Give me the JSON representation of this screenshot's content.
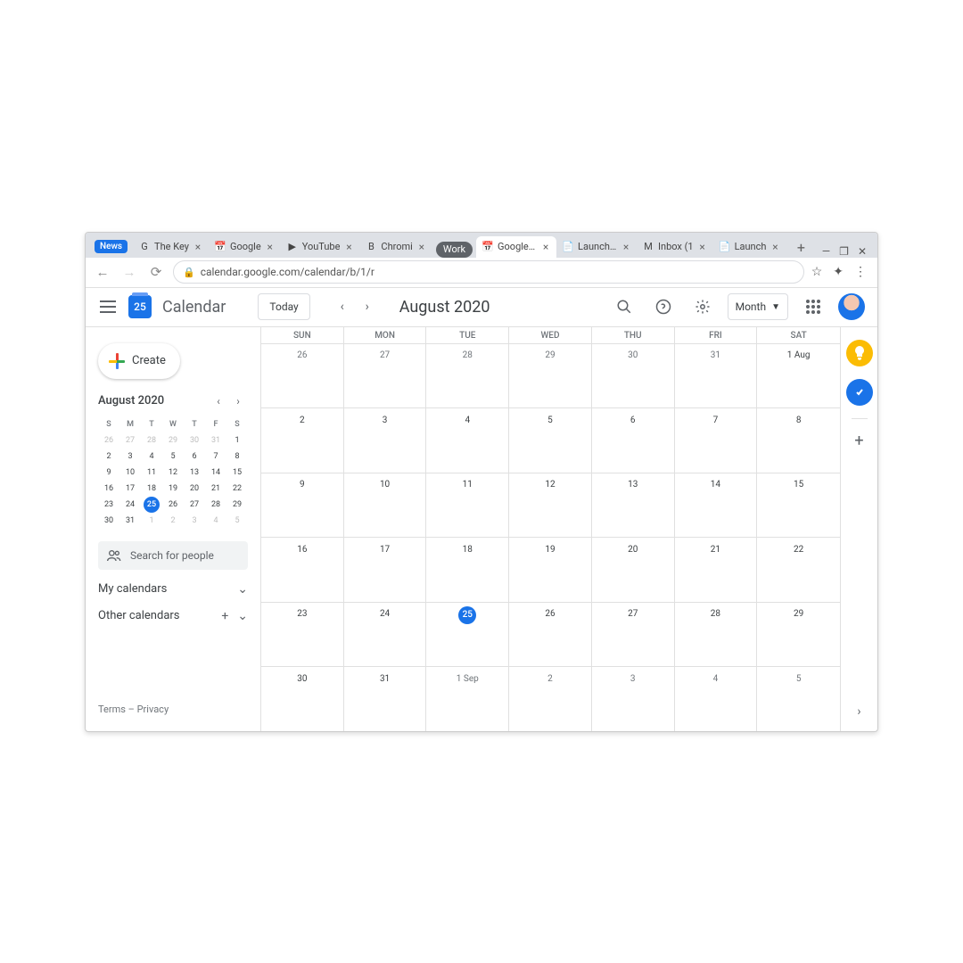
{
  "browser": {
    "tabs": [
      {
        "label": "News",
        "kind": "pill"
      },
      {
        "label": "The Key",
        "icon": "G"
      },
      {
        "label": "Google",
        "icon": "📅"
      },
      {
        "label": "YouTube",
        "icon": "▶"
      },
      {
        "label": "Chromi",
        "icon": "B"
      },
      {
        "label": "Work",
        "kind": "group"
      },
      {
        "label": "Google C",
        "icon": "📅",
        "active": true
      },
      {
        "label": "Launch Pr",
        "icon": "📄"
      },
      {
        "label": "Inbox (1",
        "icon": "M"
      },
      {
        "label": "Launch",
        "icon": "📄"
      }
    ],
    "url": "calendar.google.com/calendar/b/1/r"
  },
  "header": {
    "logo_day": "25",
    "app_title": "Calendar",
    "today_label": "Today",
    "current_range": "August 2020",
    "view_label": "Month"
  },
  "sidebar": {
    "create_label": "Create",
    "mini_title": "August 2020",
    "dows": [
      "S",
      "M",
      "T",
      "W",
      "T",
      "F",
      "S"
    ],
    "mini_days": [
      [
        26,
        27,
        28,
        29,
        30,
        31,
        1
      ],
      [
        2,
        3,
        4,
        5,
        6,
        7,
        8
      ],
      [
        9,
        10,
        11,
        12,
        13,
        14,
        15
      ],
      [
        16,
        17,
        18,
        19,
        20,
        21,
        22
      ],
      [
        23,
        24,
        25,
        26,
        27,
        28,
        29
      ],
      [
        30,
        31,
        1,
        2,
        3,
        4,
        5
      ]
    ],
    "mini_today_idx": [
      4,
      2
    ],
    "mini_other_start": true,
    "search_placeholder": "Search for people",
    "my_calendars": "My calendars",
    "other_calendars": "Other calendars",
    "footer_terms": "Terms",
    "footer_privacy": "Privacy"
  },
  "grid": {
    "dows": [
      "SUN",
      "MON",
      "TUE",
      "WED",
      "THU",
      "FRI",
      "SAT"
    ],
    "weeks": [
      [
        {
          "n": "26"
        },
        {
          "n": "27"
        },
        {
          "n": "28"
        },
        {
          "n": "29"
        },
        {
          "n": "30"
        },
        {
          "n": "31"
        },
        {
          "n": "1 Aug",
          "first": true,
          "this": true
        }
      ],
      [
        {
          "n": "2",
          "this": true
        },
        {
          "n": "3",
          "this": true
        },
        {
          "n": "4",
          "this": true
        },
        {
          "n": "5",
          "this": true
        },
        {
          "n": "6",
          "this": true
        },
        {
          "n": "7",
          "this": true
        },
        {
          "n": "8",
          "this": true
        }
      ],
      [
        {
          "n": "9",
          "this": true
        },
        {
          "n": "10",
          "this": true
        },
        {
          "n": "11",
          "this": true
        },
        {
          "n": "12",
          "this": true
        },
        {
          "n": "13",
          "this": true
        },
        {
          "n": "14",
          "this": true
        },
        {
          "n": "15",
          "this": true
        }
      ],
      [
        {
          "n": "16",
          "this": true
        },
        {
          "n": "17",
          "this": true
        },
        {
          "n": "18",
          "this": true
        },
        {
          "n": "19",
          "this": true
        },
        {
          "n": "20",
          "this": true
        },
        {
          "n": "21",
          "this": true
        },
        {
          "n": "22",
          "this": true
        }
      ],
      [
        {
          "n": "23",
          "this": true
        },
        {
          "n": "24",
          "this": true
        },
        {
          "n": "25",
          "this": true,
          "today": true
        },
        {
          "n": "26",
          "this": true
        },
        {
          "n": "27",
          "this": true
        },
        {
          "n": "28",
          "this": true
        },
        {
          "n": "29",
          "this": true
        }
      ],
      [
        {
          "n": "30",
          "this": true
        },
        {
          "n": "31",
          "this": true
        },
        {
          "n": "1 Sep",
          "first": true
        },
        {
          "n": "2"
        },
        {
          "n": "3"
        },
        {
          "n": "4"
        },
        {
          "n": "5"
        }
      ]
    ]
  }
}
